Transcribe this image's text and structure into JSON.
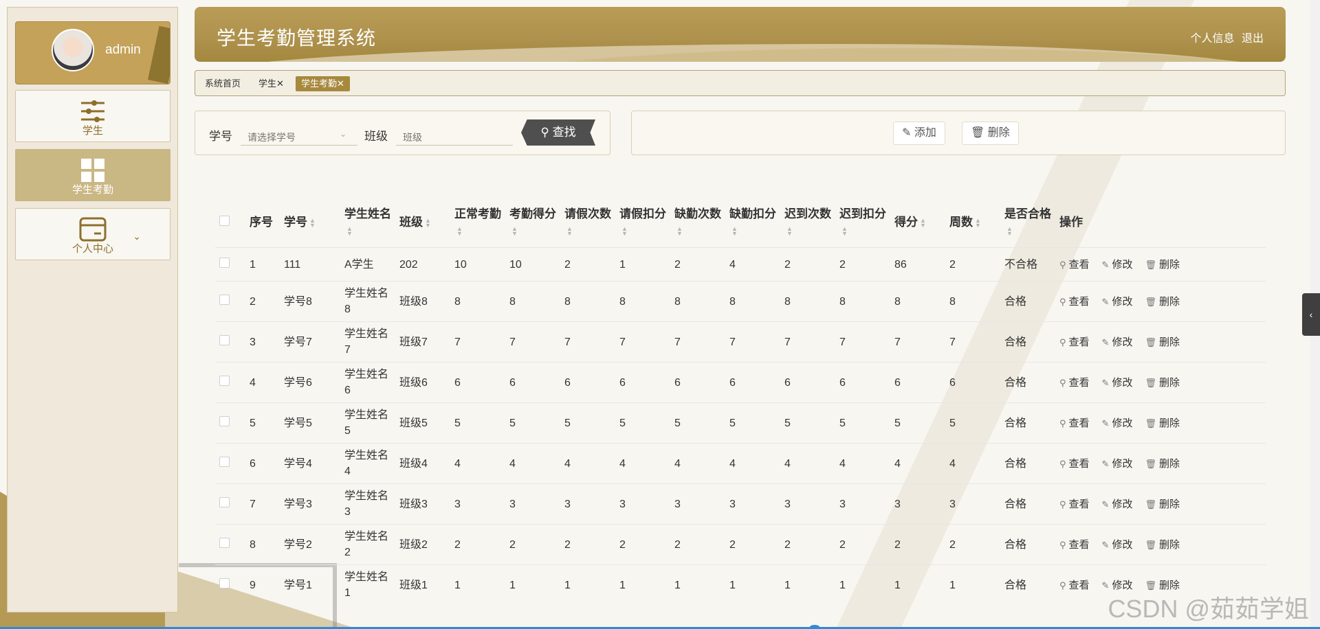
{
  "app": {
    "title": "学生考勤管理系统",
    "user_links": [
      "个人信息",
      "退出"
    ]
  },
  "user": {
    "name": "admin"
  },
  "sidebar": {
    "items": [
      {
        "label": "学生",
        "icon": "sliders-icon"
      },
      {
        "label": "学生考勤",
        "icon": "grid-icon"
      },
      {
        "label": "个人中心",
        "icon": "card-icon",
        "chevron": "chevron-down-icon"
      }
    ]
  },
  "tabs": [
    {
      "label": "系统首页",
      "closable": false
    },
    {
      "label": "学生",
      "closable": true
    },
    {
      "label": "学生考勤",
      "closable": true,
      "active": true
    }
  ],
  "search": {
    "field1_label": "学号",
    "field1_placeholder": "请选择学号",
    "field2_label": "班级",
    "field2_placeholder": "班级",
    "find_label": "查找"
  },
  "actions": {
    "add_label": "添加",
    "delete_label": "删除"
  },
  "table": {
    "columns": [
      "序号",
      "学号",
      "学生姓名",
      "班级",
      "正常考勤",
      "考勤得分",
      "请假次数",
      "请假扣分",
      "缺勤次数",
      "缺勤扣分",
      "迟到次数",
      "迟到扣分",
      "得分",
      "周数",
      "是否合格",
      "操作"
    ],
    "row_ops": [
      "查看",
      "修改",
      "删除"
    ],
    "rows": [
      [
        "1",
        "111",
        "A学生",
        "202",
        "10",
        "10",
        "2",
        "1",
        "2",
        "4",
        "2",
        "2",
        "86",
        "2",
        "不合格"
      ],
      [
        "2",
        "学号8",
        "学生姓名8",
        "班级8",
        "8",
        "8",
        "8",
        "8",
        "8",
        "8",
        "8",
        "8",
        "8",
        "8",
        "合格"
      ],
      [
        "3",
        "学号7",
        "学生姓名7",
        "班级7",
        "7",
        "7",
        "7",
        "7",
        "7",
        "7",
        "7",
        "7",
        "7",
        "7",
        "合格"
      ],
      [
        "4",
        "学号6",
        "学生姓名6",
        "班级6",
        "6",
        "6",
        "6",
        "6",
        "6",
        "6",
        "6",
        "6",
        "6",
        "6",
        "合格"
      ],
      [
        "5",
        "学号5",
        "学生姓名5",
        "班级5",
        "5",
        "5",
        "5",
        "5",
        "5",
        "5",
        "5",
        "5",
        "5",
        "5",
        "合格"
      ],
      [
        "6",
        "学号4",
        "学生姓名4",
        "班级4",
        "4",
        "4",
        "4",
        "4",
        "4",
        "4",
        "4",
        "4",
        "4",
        "4",
        "合格"
      ],
      [
        "7",
        "学号3",
        "学生姓名3",
        "班级3",
        "3",
        "3",
        "3",
        "3",
        "3",
        "3",
        "3",
        "3",
        "3",
        "3",
        "合格"
      ],
      [
        "8",
        "学号2",
        "学生姓名2",
        "班级2",
        "2",
        "2",
        "2",
        "2",
        "2",
        "2",
        "2",
        "2",
        "2",
        "2",
        "合格"
      ],
      [
        "9",
        "学号1",
        "学生姓名1",
        "班级1",
        "1",
        "1",
        "1",
        "1",
        "1",
        "1",
        "1",
        "1",
        "1",
        "1",
        "合格"
      ]
    ]
  },
  "watermark": "CSDN @茹茹学姐",
  "colors": {
    "accent": "#a7893e",
    "sidebar_active": "#c9b784",
    "search_button": "#4f4f4f"
  }
}
